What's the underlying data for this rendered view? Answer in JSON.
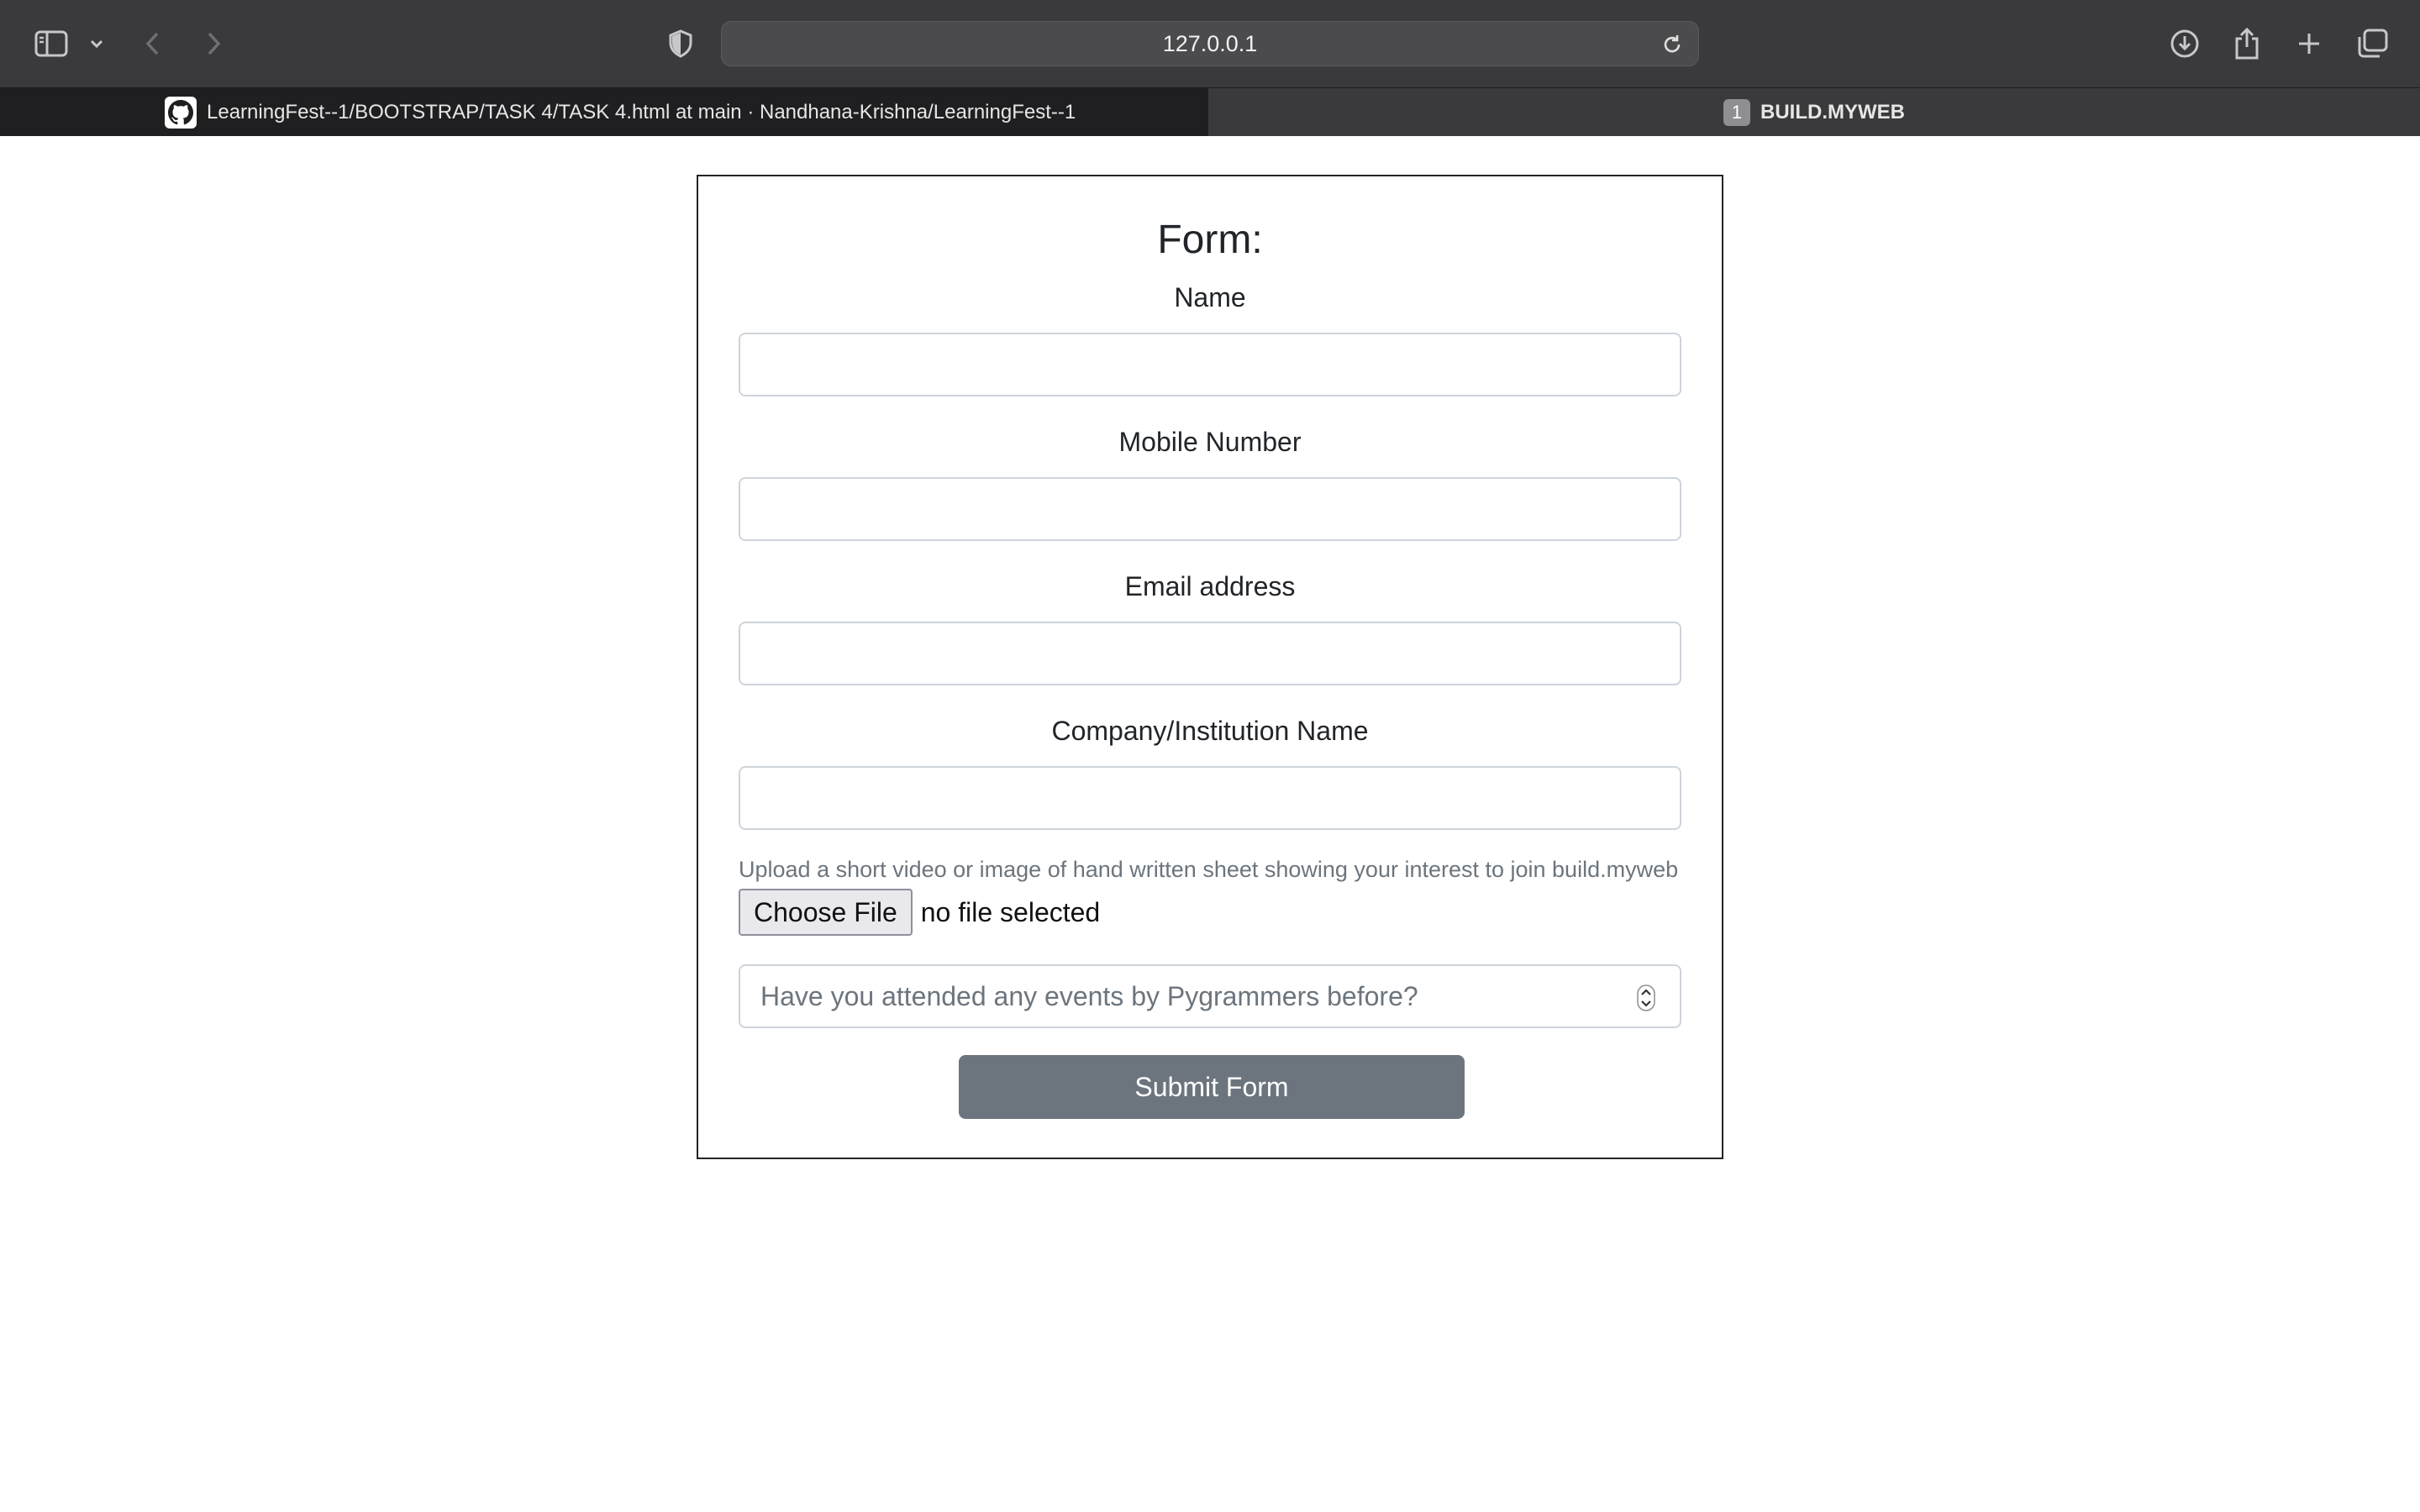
{
  "browser": {
    "address": "127.0.0.1",
    "tabs": [
      {
        "label": "LearningFest--1/BOOTSTRAP/TASK 4/TASK 4.html at main · Nandhana-Krishna/LearningFest--1",
        "icon": "github-icon"
      },
      {
        "label": "BUILD.MYWEB",
        "badge": "1"
      }
    ]
  },
  "form": {
    "title": "Form:",
    "fields": [
      {
        "label": "Name",
        "value": ""
      },
      {
        "label": "Mobile Number",
        "value": ""
      },
      {
        "label": "Email address",
        "value": ""
      },
      {
        "label": "Company/Institution Name",
        "value": ""
      }
    ],
    "upload_help": "Upload a short video or image of hand written sheet showing your interest to join build.myweb",
    "choose_file_label": "Choose File",
    "file_status": "no file selected",
    "select_placeholder": "Have you attended any events by Pygrammers before?",
    "submit_label": "Submit Form"
  }
}
